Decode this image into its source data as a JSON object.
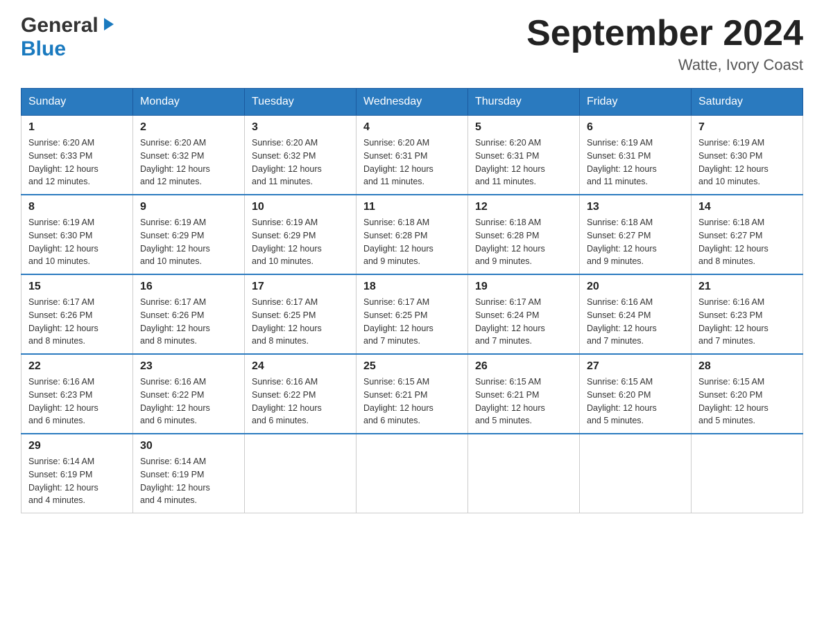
{
  "logo": {
    "general": "General",
    "blue": "Blue",
    "arrow": "▶"
  },
  "title": "September 2024",
  "location": "Watte, Ivory Coast",
  "days_of_week": [
    "Sunday",
    "Monday",
    "Tuesday",
    "Wednesday",
    "Thursday",
    "Friday",
    "Saturday"
  ],
  "weeks": [
    [
      {
        "day": "1",
        "sunrise": "6:20 AM",
        "sunset": "6:33 PM",
        "daylight": "12 hours and 12 minutes."
      },
      {
        "day": "2",
        "sunrise": "6:20 AM",
        "sunset": "6:32 PM",
        "daylight": "12 hours and 12 minutes."
      },
      {
        "day": "3",
        "sunrise": "6:20 AM",
        "sunset": "6:32 PM",
        "daylight": "12 hours and 11 minutes."
      },
      {
        "day": "4",
        "sunrise": "6:20 AM",
        "sunset": "6:31 PM",
        "daylight": "12 hours and 11 minutes."
      },
      {
        "day": "5",
        "sunrise": "6:20 AM",
        "sunset": "6:31 PM",
        "daylight": "12 hours and 11 minutes."
      },
      {
        "day": "6",
        "sunrise": "6:19 AM",
        "sunset": "6:31 PM",
        "daylight": "12 hours and 11 minutes."
      },
      {
        "day": "7",
        "sunrise": "6:19 AM",
        "sunset": "6:30 PM",
        "daylight": "12 hours and 10 minutes."
      }
    ],
    [
      {
        "day": "8",
        "sunrise": "6:19 AM",
        "sunset": "6:30 PM",
        "daylight": "12 hours and 10 minutes."
      },
      {
        "day": "9",
        "sunrise": "6:19 AM",
        "sunset": "6:29 PM",
        "daylight": "12 hours and 10 minutes."
      },
      {
        "day": "10",
        "sunrise": "6:19 AM",
        "sunset": "6:29 PM",
        "daylight": "12 hours and 10 minutes."
      },
      {
        "day": "11",
        "sunrise": "6:18 AM",
        "sunset": "6:28 PM",
        "daylight": "12 hours and 9 minutes."
      },
      {
        "day": "12",
        "sunrise": "6:18 AM",
        "sunset": "6:28 PM",
        "daylight": "12 hours and 9 minutes."
      },
      {
        "day": "13",
        "sunrise": "6:18 AM",
        "sunset": "6:27 PM",
        "daylight": "12 hours and 9 minutes."
      },
      {
        "day": "14",
        "sunrise": "6:18 AM",
        "sunset": "6:27 PM",
        "daylight": "12 hours and 8 minutes."
      }
    ],
    [
      {
        "day": "15",
        "sunrise": "6:17 AM",
        "sunset": "6:26 PM",
        "daylight": "12 hours and 8 minutes."
      },
      {
        "day": "16",
        "sunrise": "6:17 AM",
        "sunset": "6:26 PM",
        "daylight": "12 hours and 8 minutes."
      },
      {
        "day": "17",
        "sunrise": "6:17 AM",
        "sunset": "6:25 PM",
        "daylight": "12 hours and 8 minutes."
      },
      {
        "day": "18",
        "sunrise": "6:17 AM",
        "sunset": "6:25 PM",
        "daylight": "12 hours and 7 minutes."
      },
      {
        "day": "19",
        "sunrise": "6:17 AM",
        "sunset": "6:24 PM",
        "daylight": "12 hours and 7 minutes."
      },
      {
        "day": "20",
        "sunrise": "6:16 AM",
        "sunset": "6:24 PM",
        "daylight": "12 hours and 7 minutes."
      },
      {
        "day": "21",
        "sunrise": "6:16 AM",
        "sunset": "6:23 PM",
        "daylight": "12 hours and 7 minutes."
      }
    ],
    [
      {
        "day": "22",
        "sunrise": "6:16 AM",
        "sunset": "6:23 PM",
        "daylight": "12 hours and 6 minutes."
      },
      {
        "day": "23",
        "sunrise": "6:16 AM",
        "sunset": "6:22 PM",
        "daylight": "12 hours and 6 minutes."
      },
      {
        "day": "24",
        "sunrise": "6:16 AM",
        "sunset": "6:22 PM",
        "daylight": "12 hours and 6 minutes."
      },
      {
        "day": "25",
        "sunrise": "6:15 AM",
        "sunset": "6:21 PM",
        "daylight": "12 hours and 6 minutes."
      },
      {
        "day": "26",
        "sunrise": "6:15 AM",
        "sunset": "6:21 PM",
        "daylight": "12 hours and 5 minutes."
      },
      {
        "day": "27",
        "sunrise": "6:15 AM",
        "sunset": "6:20 PM",
        "daylight": "12 hours and 5 minutes."
      },
      {
        "day": "28",
        "sunrise": "6:15 AM",
        "sunset": "6:20 PM",
        "daylight": "12 hours and 5 minutes."
      }
    ],
    [
      {
        "day": "29",
        "sunrise": "6:14 AM",
        "sunset": "6:19 PM",
        "daylight": "12 hours and 4 minutes."
      },
      {
        "day": "30",
        "sunrise": "6:14 AM",
        "sunset": "6:19 PM",
        "daylight": "12 hours and 4 minutes."
      },
      null,
      null,
      null,
      null,
      null
    ]
  ],
  "labels": {
    "sunrise": "Sunrise:",
    "sunset": "Sunset:",
    "daylight": "Daylight:"
  }
}
